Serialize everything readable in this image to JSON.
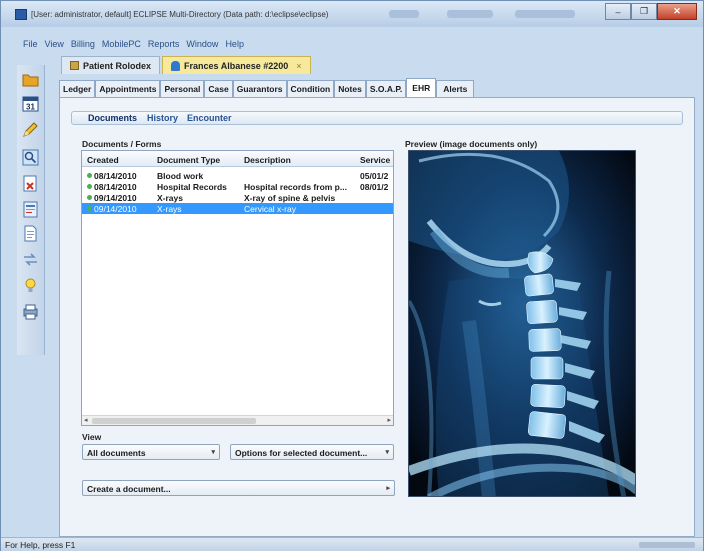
{
  "window": {
    "title": "[User: administrator, default]  ECLIPSE Multi-Directory (Data path: d:\\eclipse\\eclipse)",
    "min_label": "–",
    "max_label": "❐",
    "close_label": "✕"
  },
  "menu": [
    "File",
    "View",
    "Billing",
    "MobilePC",
    "Reports",
    "Window",
    "Help"
  ],
  "doc_tabs": {
    "rolodex": "Patient Rolodex",
    "patient": "Frances Albanese #2200",
    "patient_close": "×"
  },
  "form_tabs": [
    "Ledger",
    "Appointments",
    "Personal",
    "Case",
    "Guarantors",
    "Condition",
    "Notes",
    "S.O.A.P.",
    "EHR",
    "Alerts"
  ],
  "active_form_tab": "EHR",
  "sub_tabs": [
    "Documents",
    "History",
    "Encounter"
  ],
  "documents_label": "Documents / Forms",
  "preview_label": "Preview (image documents only)",
  "grid": {
    "columns": [
      "Created",
      "Document Type",
      "Description",
      "Service"
    ],
    "rows": [
      {
        "created": "08/14/2010",
        "type": "Blood work",
        "description": "",
        "service": "05/01/2"
      },
      {
        "created": "08/14/2010",
        "type": "Hospital Records",
        "description": "Hospital records from p...",
        "service": "08/01/2"
      },
      {
        "created": "09/14/2010",
        "type": "X-rays",
        "description": "X-ray of spine & pelvis",
        "service": ""
      },
      {
        "created": "09/14/2010",
        "type": "X-rays",
        "description": "Cervical x-ray",
        "service": ""
      }
    ],
    "selected_row": 3,
    "status_dot_color": "#4caf50",
    "selection_color": "#3399ff"
  },
  "view_label": "View",
  "view_select": "All documents",
  "options_button": "Options for selected document...",
  "create_button": "Create a document...",
  "status_bar": "For Help, press F1",
  "sidebar_icons": [
    "folder-icon",
    "calendar-icon",
    "pencil-icon",
    "patient-search-icon",
    "remove-icon",
    "form-icon",
    "document-icon",
    "transfer-icon",
    "lightbulb-icon",
    "printer-icon"
  ],
  "calendar_day": "31"
}
